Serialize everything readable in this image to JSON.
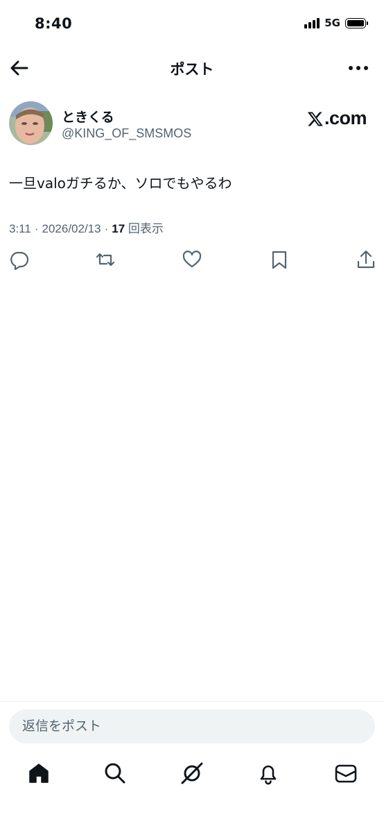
{
  "status_bar": {
    "time": "8:40",
    "network": "5G"
  },
  "header": {
    "title": "ポスト",
    "back_icon": "arrow-left-icon",
    "more_icon": "more-horizontal-icon"
  },
  "post": {
    "author": {
      "display_name": "ときくる",
      "handle": "@KING_OF_SMSMOS"
    },
    "watermark": ".com",
    "text": "一旦valoガチるか、ソロでもやるわ",
    "time": "3:11",
    "date": "2026/02/13",
    "views_count": "17",
    "views_label": "回表示",
    "actions": [
      "reply-icon",
      "repost-icon",
      "like-icon",
      "bookmark-icon",
      "share-icon"
    ]
  },
  "reply": {
    "placeholder": "返信をポスト"
  },
  "tabbar": {
    "items": [
      "home-icon",
      "search-icon",
      "grok-icon",
      "notifications-icon",
      "messages-icon"
    ]
  },
  "colors": {
    "text": "#0f1419",
    "secondary": "#536471",
    "input_bg": "#eff3f4"
  }
}
